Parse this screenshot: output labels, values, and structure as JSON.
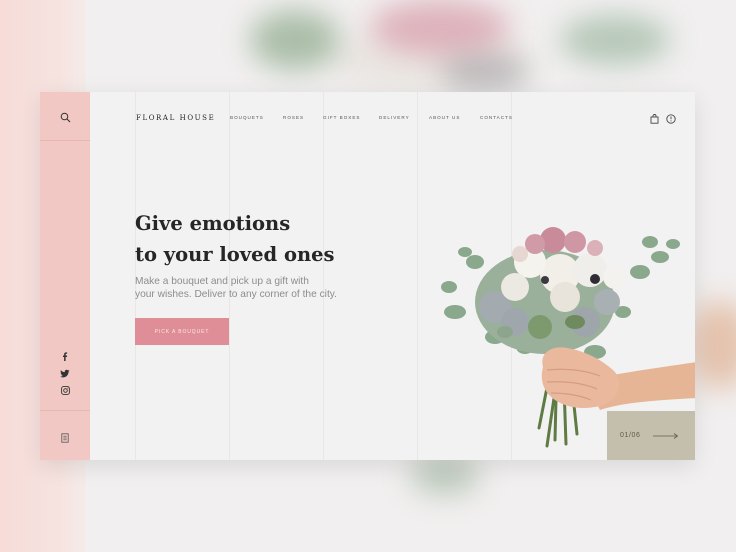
{
  "brand": {
    "logo_text": "FLORAL  HOUSE"
  },
  "nav": {
    "items": [
      "BOUQUETS",
      "ROSES",
      "GIFT BOXES",
      "DELIVERY",
      "ABOUT US",
      "CONTACTS"
    ]
  },
  "sidebar": {
    "icons": [
      "search-icon",
      "facebook-icon",
      "twitter-icon",
      "instagram-icon",
      "menu-icon"
    ]
  },
  "header_icons": [
    "cart-icon",
    "language-icon"
  ],
  "hero": {
    "title_line1": "Give emotions",
    "title_line2": "to your loved ones",
    "subtitle_line1": "Make a bouquet and pick up a gift with",
    "subtitle_line2": "your wishes. Deliver to any corner of the city.",
    "cta_label": "PICK A BOUQUET"
  },
  "slider": {
    "counter": "01/06"
  },
  "colors": {
    "accent_pink": "#df8d97",
    "sidebar_pink": "#f1c8c3",
    "slider_beige": "#c4bfad",
    "title_dark": "#262626"
  }
}
